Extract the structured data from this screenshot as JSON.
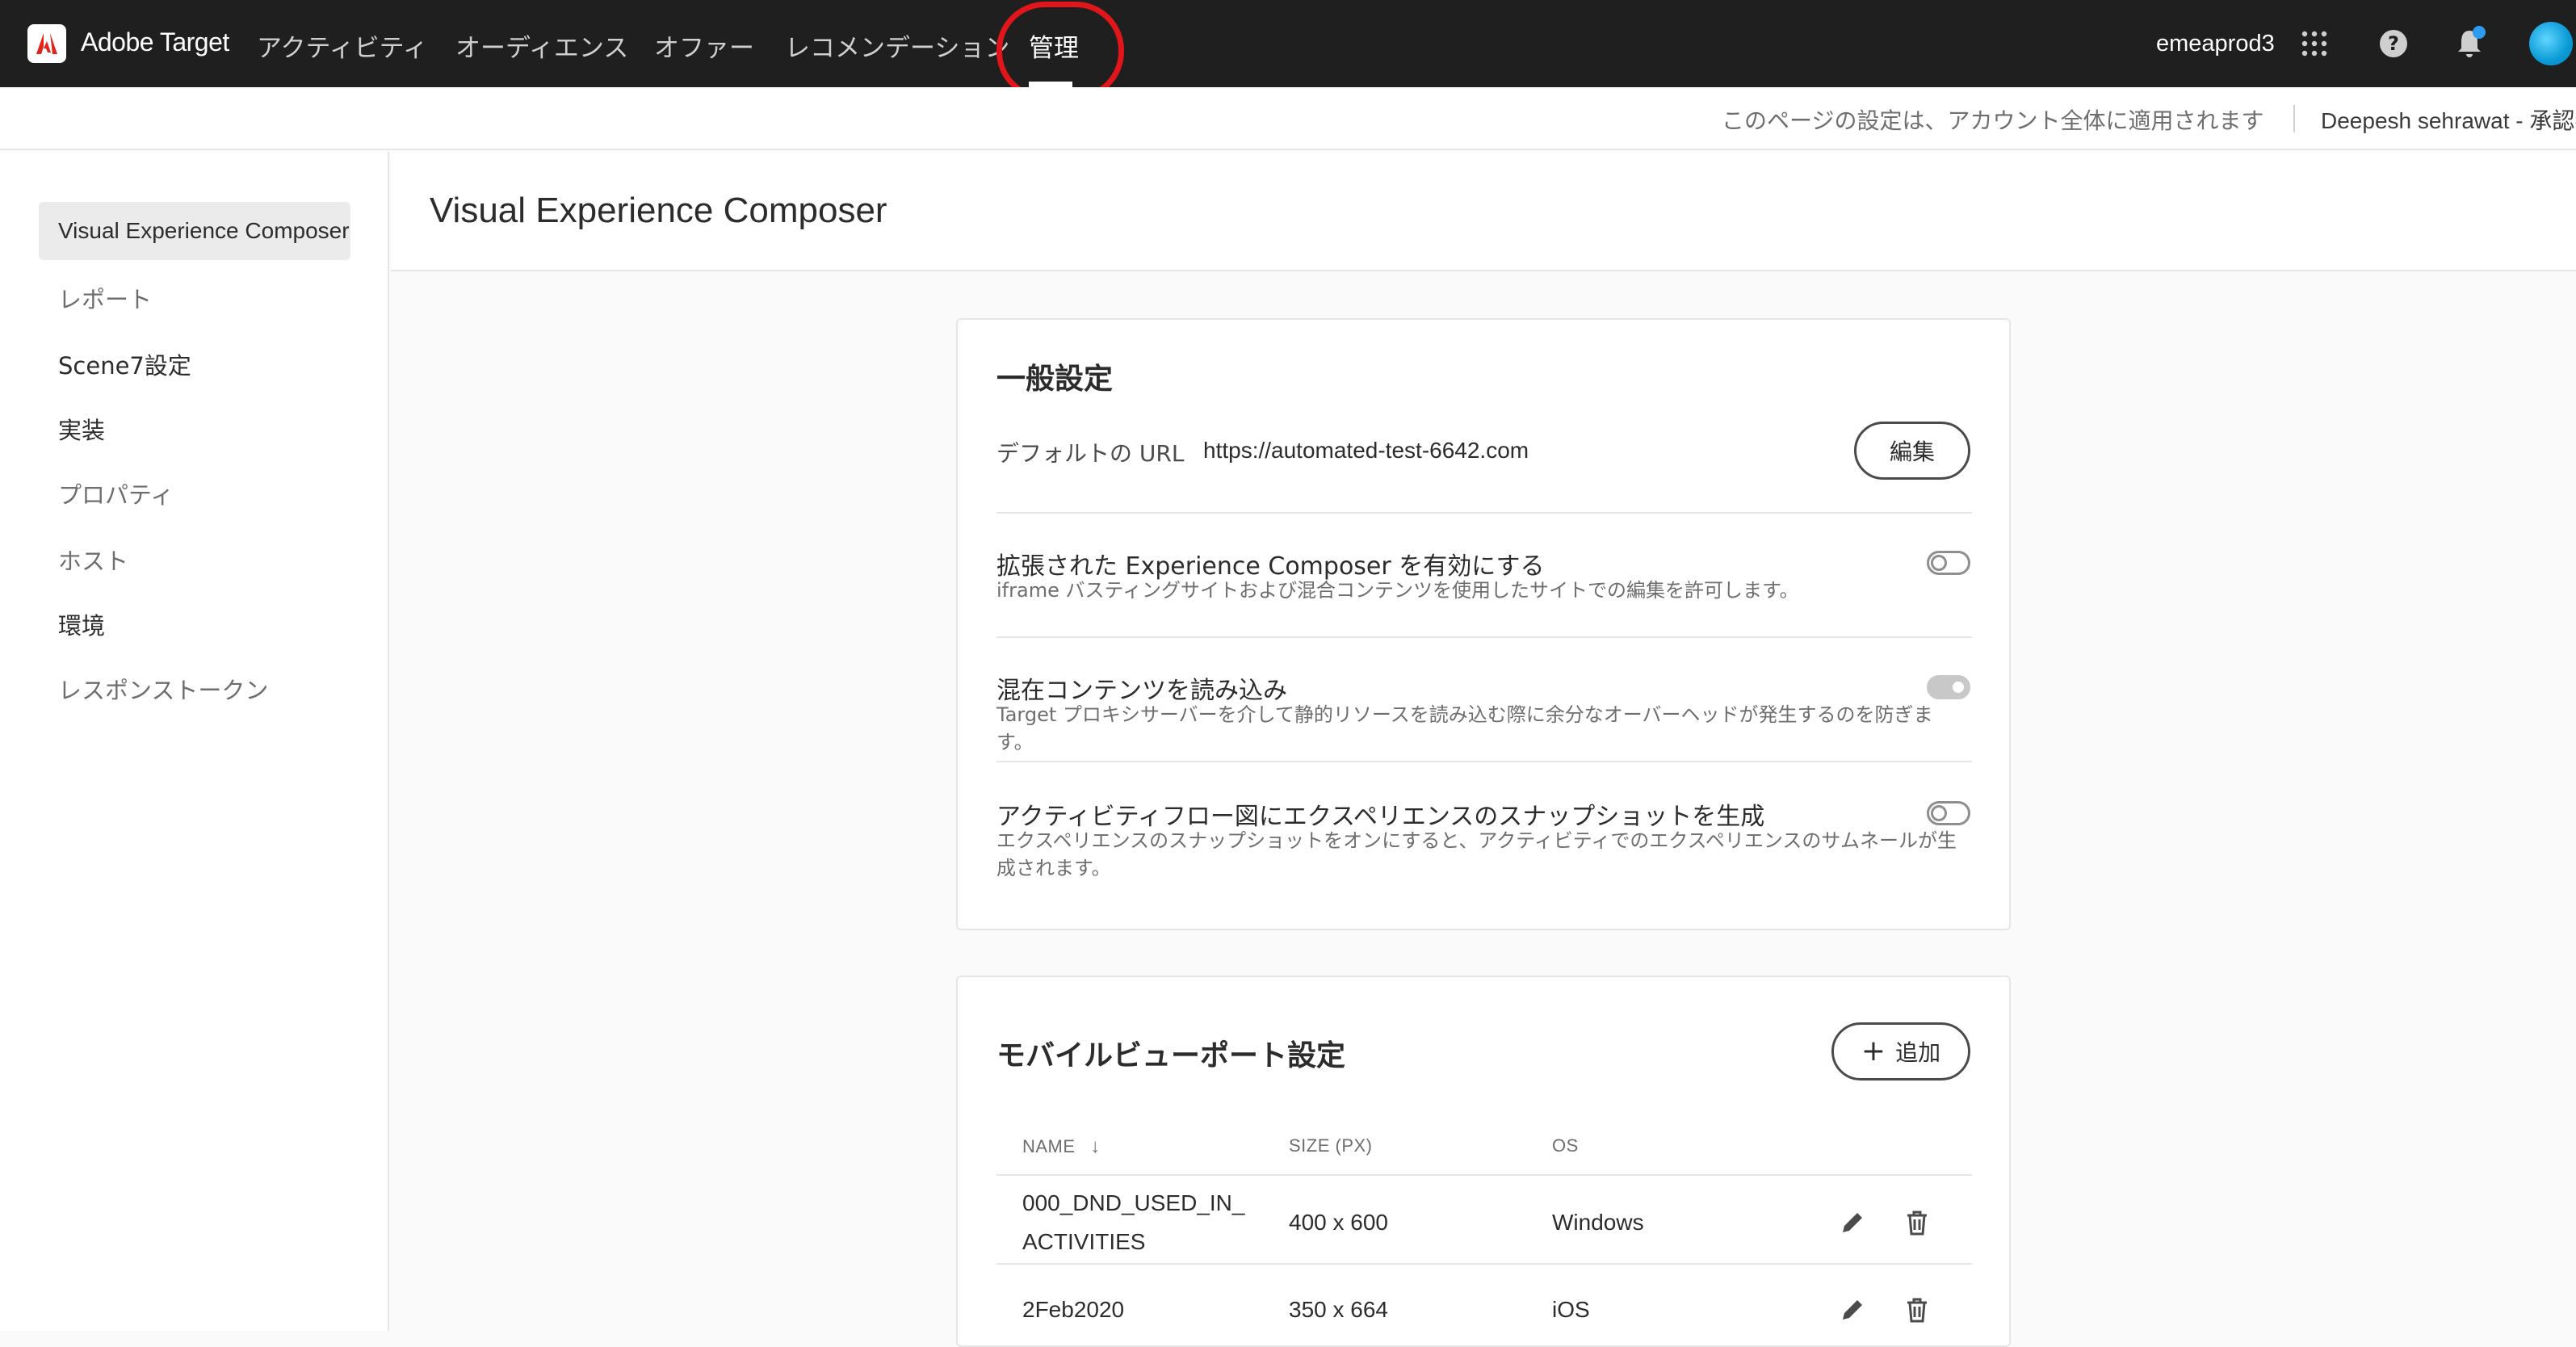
{
  "app": {
    "name": "Adobe Target"
  },
  "nav": {
    "items": [
      {
        "label": "アクティビティ"
      },
      {
        "label": "オーディエンス"
      },
      {
        "label": "オファー"
      },
      {
        "label": "レコメンデーション"
      },
      {
        "label": "管理",
        "active": true
      }
    ]
  },
  "header": {
    "org": "emeaprod3"
  },
  "subbar": {
    "account_note": "このページの設定は、アカウント全体に適用されます",
    "user": "Deepesh sehrawat - 承認者"
  },
  "leftnav": {
    "items": [
      {
        "label": "Visual Experience Composer",
        "selected": true
      },
      {
        "label": "レポート"
      },
      {
        "label": "Scene7設定"
      },
      {
        "label": "実装"
      },
      {
        "label": "プロパティ"
      },
      {
        "label": "ホスト"
      },
      {
        "label": "環境"
      },
      {
        "label": "レスポンストークン"
      }
    ]
  },
  "page": {
    "title": "Visual Experience Composer"
  },
  "general": {
    "title": "一般設定",
    "default_url_label": "デフォルトの URL",
    "default_url": "https://automated-test-6642.com",
    "edit_label": "編集",
    "settings": [
      {
        "title": "拡張された Experience Composer を有効にする",
        "desc": "iframe バスティングサイトおよび混合コンテンツを使用したサイトでの編集を許可します。",
        "state": "off"
      },
      {
        "title": "混在コンテンツを読み込み",
        "desc": "Target プロキシサーバーを介して静的リソースを読み込む際に余分なオーバーヘッドが発生するのを防ぎます。",
        "state": "on-disabled"
      },
      {
        "title": "アクティビティフロー図にエクスペリエンスのスナップショットを生成",
        "desc": "エクスペリエンスのスナップショットをオンにすると、アクティビティでのエクスペリエンスのサムネールが生成されます。",
        "state": "off"
      }
    ]
  },
  "mobile": {
    "title": "モバイルビューポート設定",
    "add_label": "追加",
    "columns": [
      "NAME",
      "SIZE (PX)",
      "OS"
    ],
    "rows": [
      {
        "name": "000_DND_USED_IN_ACTIVITIES",
        "size": "400 x 600",
        "os": "Windows"
      },
      {
        "name": "2Feb2020",
        "size": "350 x 664",
        "os": "iOS"
      }
    ]
  },
  "colors": {
    "topbar": "#1f1f1f",
    "highlight": "#e0161a",
    "notification": "#2d9cf0"
  }
}
